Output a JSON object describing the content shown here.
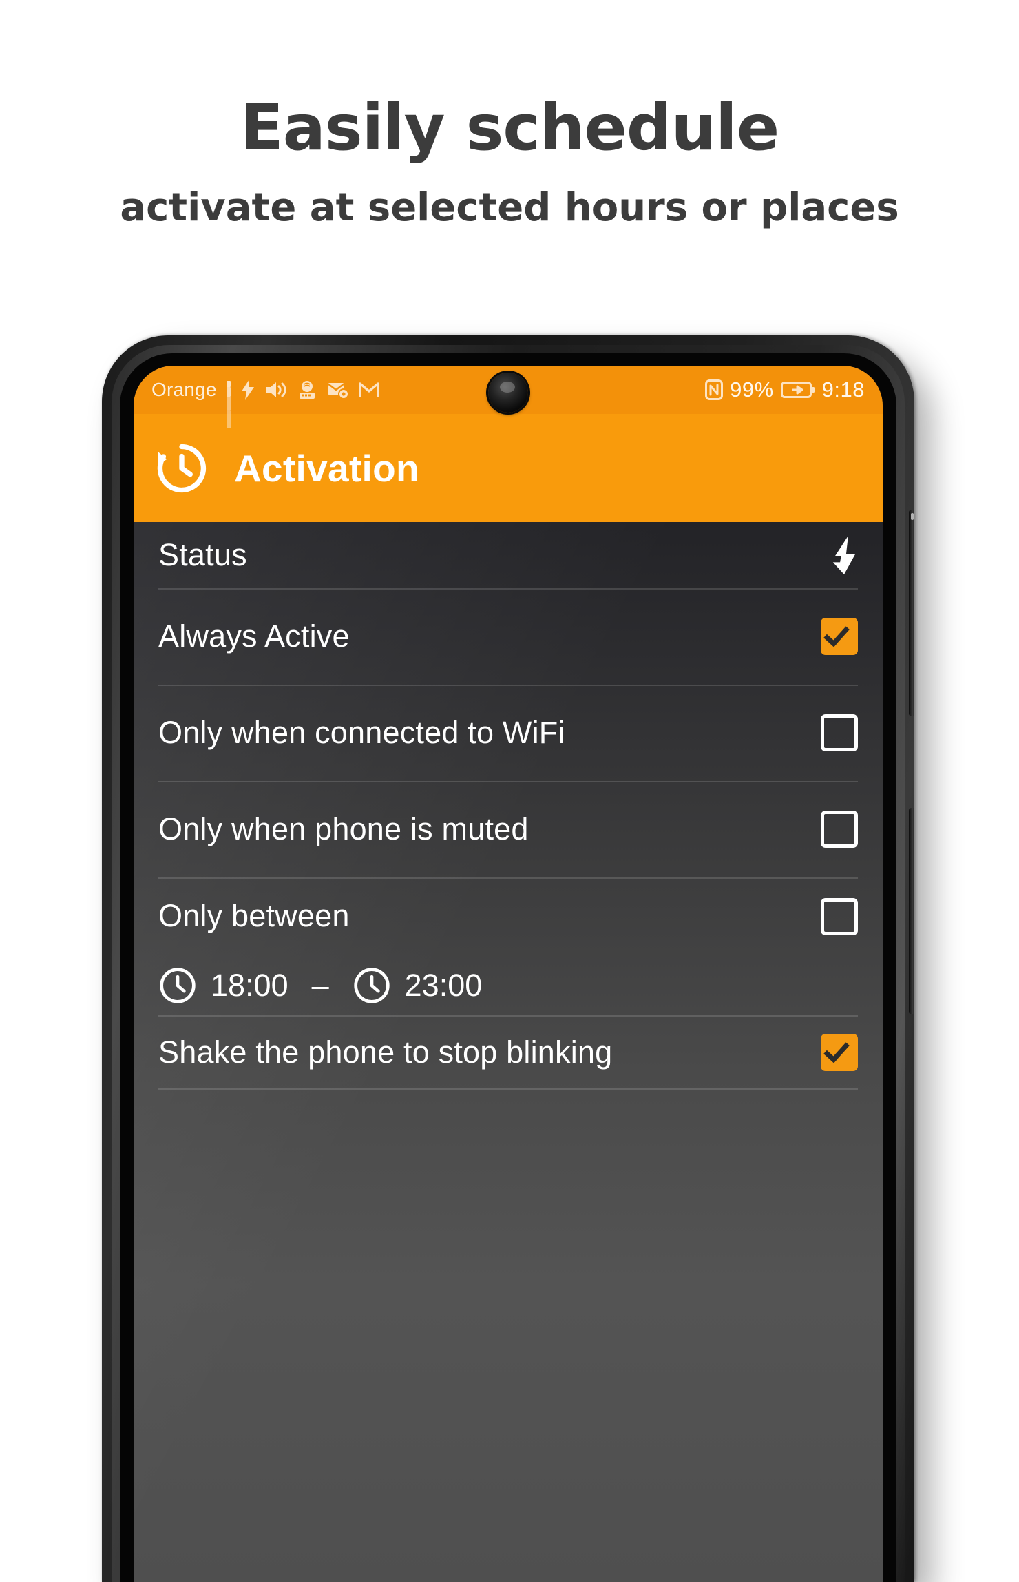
{
  "promo": {
    "title": "Easily schedule",
    "subtitle": "activate at selected hours or places"
  },
  "colors": {
    "accent_orange": "#F99B0C",
    "statusbar_orange": "#F3910A",
    "checkbox_on": "#F59A12",
    "list_top": "#232327",
    "list_bottom": "#545454",
    "text_white": "#FFFFFF",
    "promo_text": "#3C3C3C"
  },
  "phone": {
    "statusbar": {
      "carrier": "Orange",
      "icons_left": [
        "signal-bars-icon",
        "flash-icon",
        "volume-icon",
        "radio-mic-icon",
        "mail-settings-icon",
        "gmail-icon"
      ],
      "nfc_icon": "nfc-icon",
      "battery_percent": "99%",
      "battery_icon": "battery-charging-icon",
      "time": "9:18",
      "camera": "front-camera-punch-hole"
    },
    "appbar": {
      "icon": "history-clock-icon",
      "title": "Activation"
    },
    "list": {
      "rows": [
        {
          "label": "Status",
          "type": "icon",
          "icon": "flash-bolt-icon"
        },
        {
          "label": "Always Active",
          "type": "checkbox",
          "checked": true
        },
        {
          "label": "Only when connected to WiFi",
          "type": "checkbox",
          "checked": false
        },
        {
          "label": "Only when phone is muted",
          "type": "checkbox",
          "checked": false
        },
        {
          "label": "Only between",
          "type": "checkbox-times",
          "checked": false
        },
        {
          "label": "Shake the phone to stop blinking",
          "type": "checkbox",
          "checked": true
        }
      ],
      "time_range": {
        "start_icon": "clock-icon",
        "start": "18:00",
        "separator": "–",
        "end_icon": "clock-icon",
        "end": "23:00"
      }
    }
  }
}
